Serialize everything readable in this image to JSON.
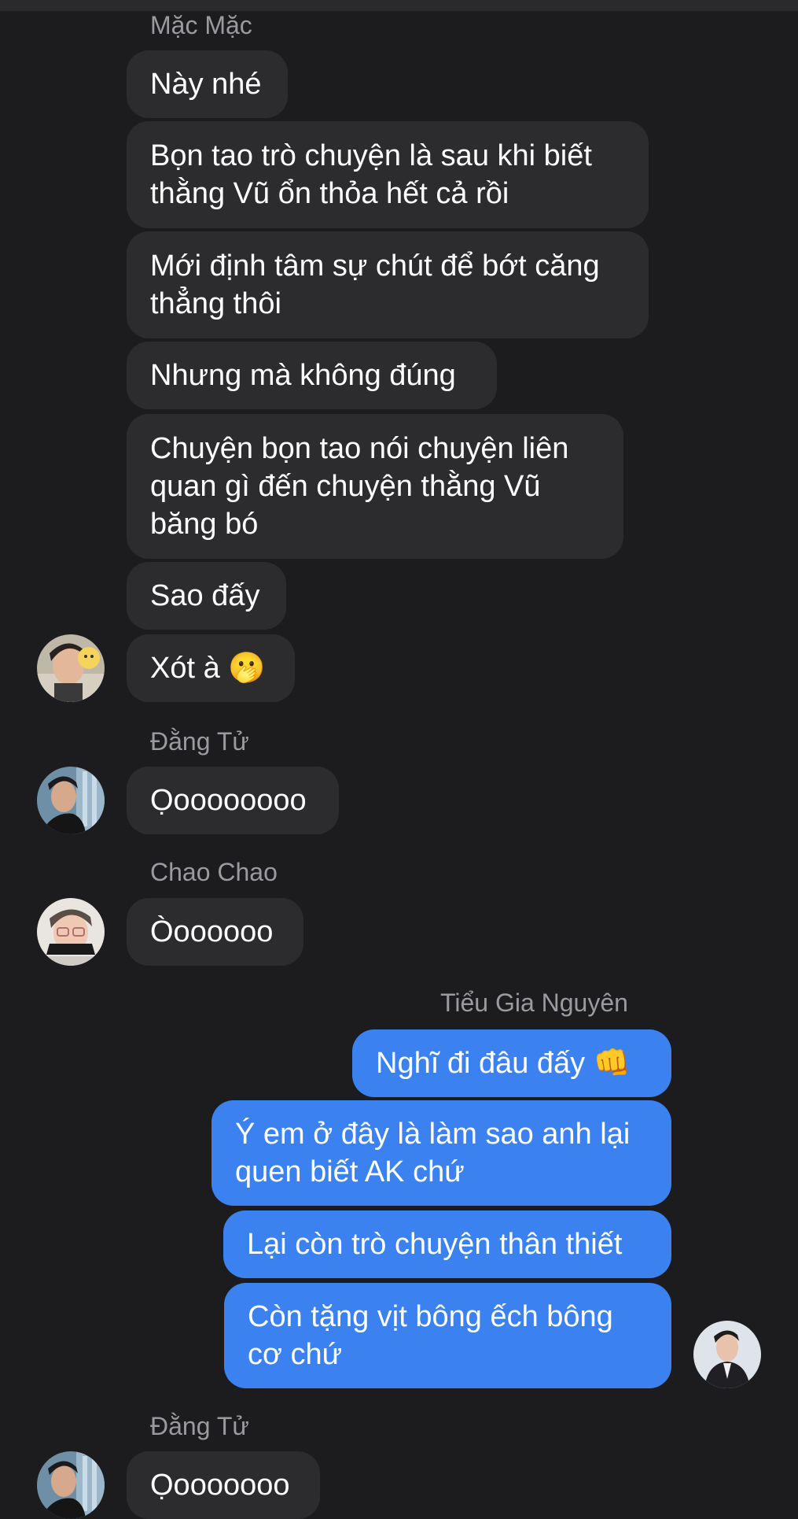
{
  "messages": {
    "sender_1": "Mặc Mặc",
    "m1": "Này nhé",
    "m2": "Bọn tao trò chuyện là sau khi biết thằng Vũ ổn thỏa hết cả rồi",
    "m3": "Mới định tâm sự chút để bớt căng thẳng thôi",
    "m4": "Nhưng mà không đúng",
    "m5": "Chuyện bọn tao nói chuyện liên quan gì đến chuyện thằng Vũ băng bó",
    "m6": "Sao đấy",
    "m7": "Xót à 🫢",
    "sender_2": "Đằng Tử",
    "m8": "Ọoooooooo",
    "sender_3": "Chao Chao",
    "m9": "Òoooooo",
    "sender_4": "Tiểu Gia Nguyên",
    "m10": "Nghĩ đi đâu đấy 👊",
    "m11": "Ý em ở đây là làm sao anh lại quen biết AK chứ",
    "m12": "Lại còn trò chuyện thân thiết",
    "m13": "Còn tặng vịt bông ếch bông cơ chứ",
    "sender_5": "Đằng Tử",
    "m14": "Ọooooooo"
  },
  "colors": {
    "background": "#1c1c1e",
    "incoming_bubble": "#2c2c2e",
    "outgoing_bubble": "#3b82f0",
    "sender_name": "#9a9a9f"
  }
}
